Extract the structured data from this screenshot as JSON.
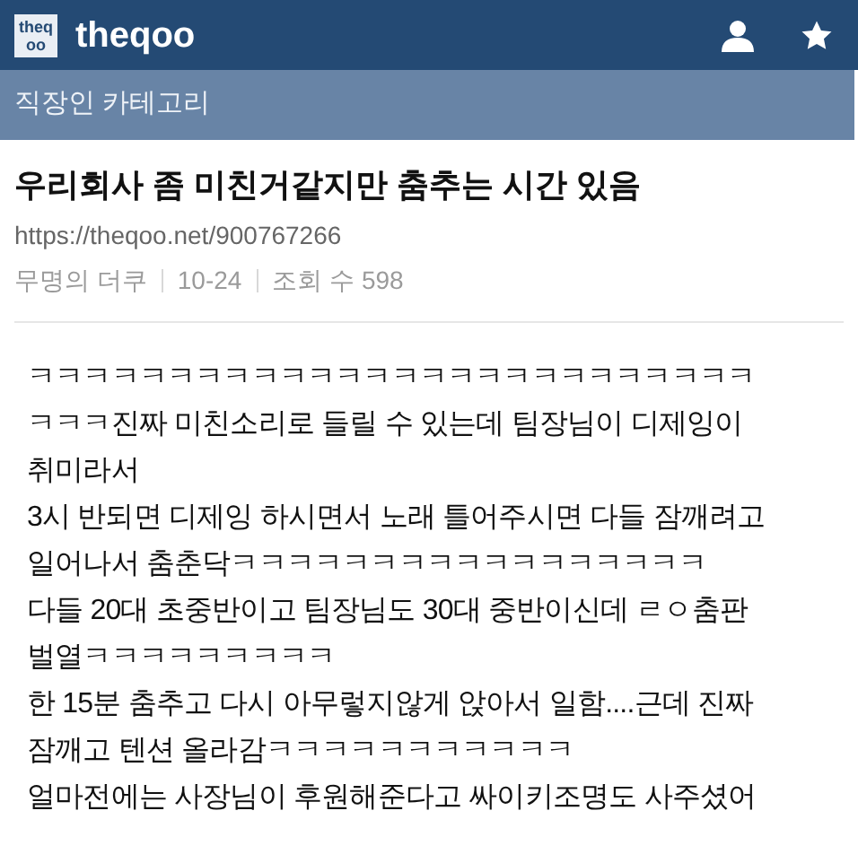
{
  "header": {
    "logo_text": "theqoo",
    "site_name": "theqoo"
  },
  "category": "직장인 카테고리",
  "post": {
    "title": "우리회사 좀 미친거같지만 춤추는 시간 있음",
    "url": "https://theqoo.net/900767266",
    "meta": [
      "무명의 더쿠",
      "10-24",
      "조회 수 598"
    ],
    "body": [
      "ㅋㅋㅋㅋㅋㅋㅋㅋㅋㅋㅋㅋㅋㅋㅋㅋㅋㅋㅋㅋㅋㅋㅋㅋㅋㅋ",
      "ㅋㅋㅋ진짜 미친소리로 들릴 수 있는데 팀장님이 디제잉이",
      "취미라서",
      "3시 반되면 디제잉 하시면서 노래 틀어주시면 다들 잠깨려고",
      "일어나서 춤춘닥ㅋㅋㅋㅋㅋㅋㅋㅋㅋㅋㅋㅋㅋㅋㅋㅋㅋ",
      "다들 20대 초중반이고 팀장님도 30대 중반이신데 ㄹㅇ춤판",
      "벌열ㅋㅋㅋㅋㅋㅋㅋㅋㅋ",
      "한 15분 춤추고 다시 아무렇지않게 앉아서 일함....근데 진짜",
      "잠깨고 텐션 올라감ㅋㅋㅋㅋㅋㅋㅋㅋㅋㅋㅋ",
      "얼마전에는 사장님이 후원해준다고 싸이키조명도 사주셨어"
    ]
  }
}
